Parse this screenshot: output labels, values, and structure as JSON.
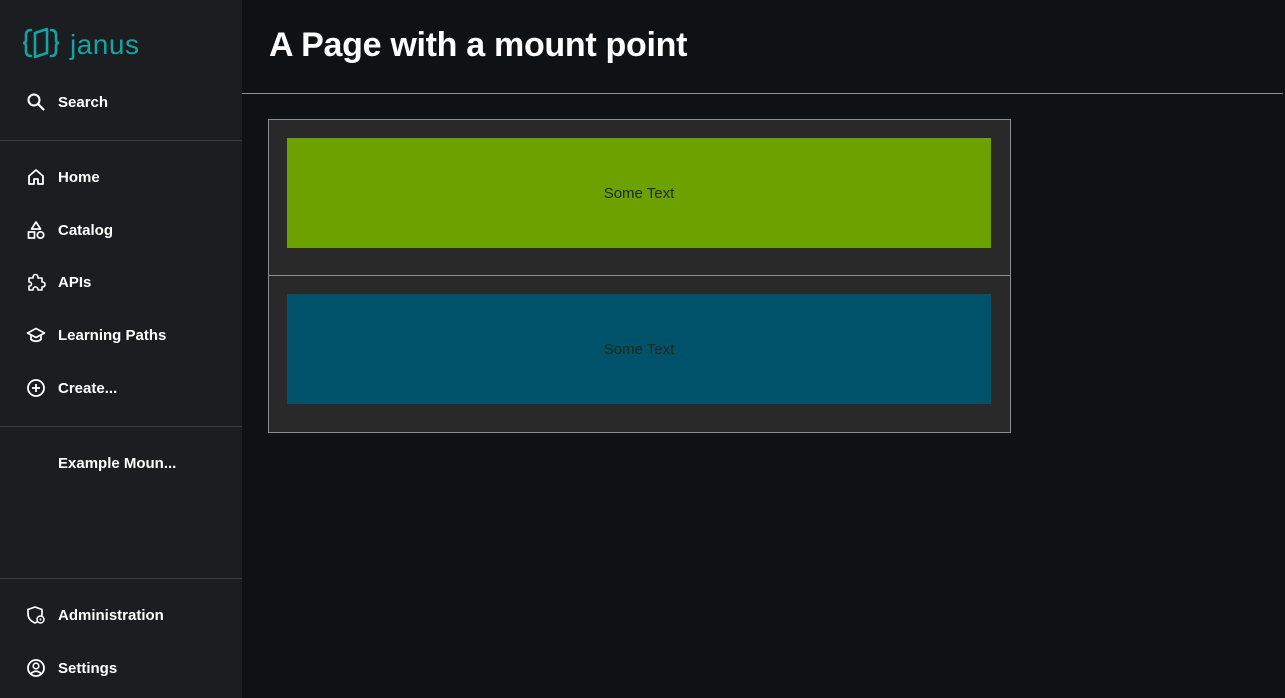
{
  "app": {
    "logo_text": "janus",
    "brand_color": "#14a3a3"
  },
  "sidebar": {
    "search": {
      "label": "Search",
      "icon": "search-icon"
    },
    "main_items": [
      {
        "label": "Home",
        "icon": "home-icon"
      },
      {
        "label": "Catalog",
        "icon": "catalog-icon"
      },
      {
        "label": "APIs",
        "icon": "puzzle-icon"
      },
      {
        "label": "Learning Paths",
        "icon": "graduation-cap-icon"
      },
      {
        "label": "Create...",
        "icon": "plus-circle-icon"
      }
    ],
    "plugin_items": [
      {
        "label": "Example Moun..."
      }
    ],
    "bottom_items": [
      {
        "label": "Administration",
        "icon": "admin-shield-icon"
      },
      {
        "label": "Settings",
        "icon": "user-circle-icon"
      }
    ]
  },
  "header": {
    "title": "A Page with a mount point"
  },
  "mount_point": {
    "cards": [
      {
        "text": "Some Text",
        "color": "#6ca100"
      },
      {
        "text": "Some Text",
        "color": "#00526b"
      }
    ]
  }
}
